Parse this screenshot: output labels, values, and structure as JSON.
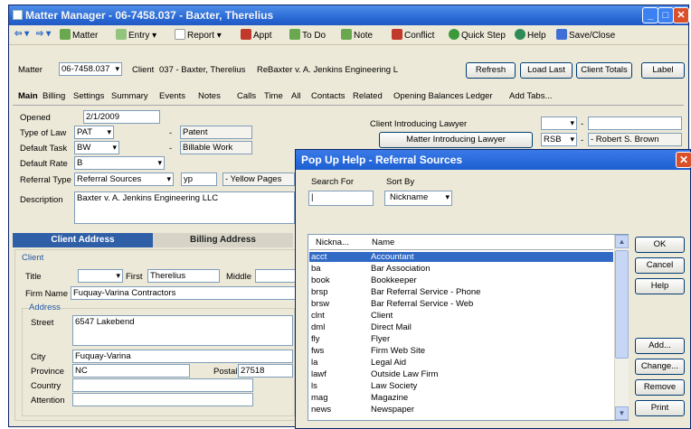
{
  "window": {
    "title": "Matter Manager - 06-7458.037 - Baxter, Therelius"
  },
  "toolbar": {
    "matter": "Matter",
    "entry": "Entry",
    "report": "Report",
    "appt": "Appt",
    "todo": "To Do",
    "note": "Note",
    "conflict": "Conflict",
    "quickstep": "Quick Step",
    "help": "Help",
    "saveclose": "Save/Close"
  },
  "header": {
    "matter_label": "Matter",
    "matter_value": "06-7458.037",
    "client_label": "Client",
    "client_value": "037 - Baxter, Therelius",
    "re_label": "Re",
    "re_value": "Baxter v. A. Jenkins Engineering L",
    "refresh": "Refresh",
    "loadlast": "Load Last",
    "clienttotals": "Client Totals",
    "label": "Label"
  },
  "tabs": [
    "Main",
    "Billing",
    "Settings",
    "Summary",
    "Events",
    "Notes",
    "Calls",
    "Time",
    "All",
    "Contacts",
    "Related",
    "Opening Balances",
    "Ledger",
    "Add Tabs..."
  ],
  "main": {
    "opened_label": "Opened",
    "opened_value": "2/1/2009",
    "typeoflaw_label": "Type of Law",
    "typeoflaw_value": "PAT",
    "typeoflaw_desc": "Patent",
    "defaulttask_label": "Default Task",
    "defaulttask_value": "BW",
    "defaulttask_desc": "Billable Work",
    "defaultrate_label": "Default Rate",
    "defaultrate_value": "B",
    "referraltype_label": "Referral Type",
    "referraltype_value": "Referral Sources",
    "referral_code": "yp",
    "referral_desc": "- Yellow Pages",
    "description_label": "Description",
    "description_value": "Baxter v. A. Jenkins Engineering LLC",
    "cil_label": "Client Introducing Lawyer",
    "mil_button": "Matter Introducing Lawyer",
    "mil_value": "RSB",
    "mil_name": "- Robert S. Brown"
  },
  "address": {
    "client_tab": "Client Address",
    "billing_tab": "Billing Address",
    "group_label": "Client",
    "title_label": "Title",
    "first_label": "First",
    "first_value": "Therelius",
    "middle_label": "Middle",
    "firmname_label": "Firm Name",
    "firmname_value": "Fuquay-Varina Contractors",
    "address_group": "Address",
    "street_label": "Street",
    "street_value": "6547 Lakebend",
    "city_label": "City",
    "city_value": "Fuquay-Varina",
    "province_label": "Province",
    "province_value": "NC",
    "postal_label": "Postal",
    "postal_value": "27518",
    "country_label": "Country",
    "attention_label": "Attention"
  },
  "popup": {
    "title": "Pop Up Help - Referral Sources",
    "searchfor_label": "Search For",
    "searchfor_value": "|",
    "sortby_label": "Sort By",
    "sortby_value": "Nickname",
    "col_nickname": "Nickna...",
    "col_name": "Name",
    "rows": [
      {
        "k": "acct",
        "v": "Accountant"
      },
      {
        "k": "ba",
        "v": "Bar Association"
      },
      {
        "k": "book",
        "v": "Bookkeeper"
      },
      {
        "k": "brsp",
        "v": "Bar Referral Service - Phone"
      },
      {
        "k": "brsw",
        "v": "Bar Referral Service - Web"
      },
      {
        "k": "clnt",
        "v": "Client"
      },
      {
        "k": "dml",
        "v": "Direct Mail"
      },
      {
        "k": "fly",
        "v": "Flyer"
      },
      {
        "k": "fws",
        "v": "Firm Web Site"
      },
      {
        "k": "la",
        "v": "Legal Aid"
      },
      {
        "k": "lawf",
        "v": "Outside Law Firm"
      },
      {
        "k": "ls",
        "v": "Law Society"
      },
      {
        "k": "mag",
        "v": "Magazine"
      },
      {
        "k": "news",
        "v": "Newspaper"
      }
    ],
    "ok": "OK",
    "cancel": "Cancel",
    "help": "Help",
    "add": "Add...",
    "change": "Change...",
    "remove": "Remove",
    "print": "Print"
  }
}
